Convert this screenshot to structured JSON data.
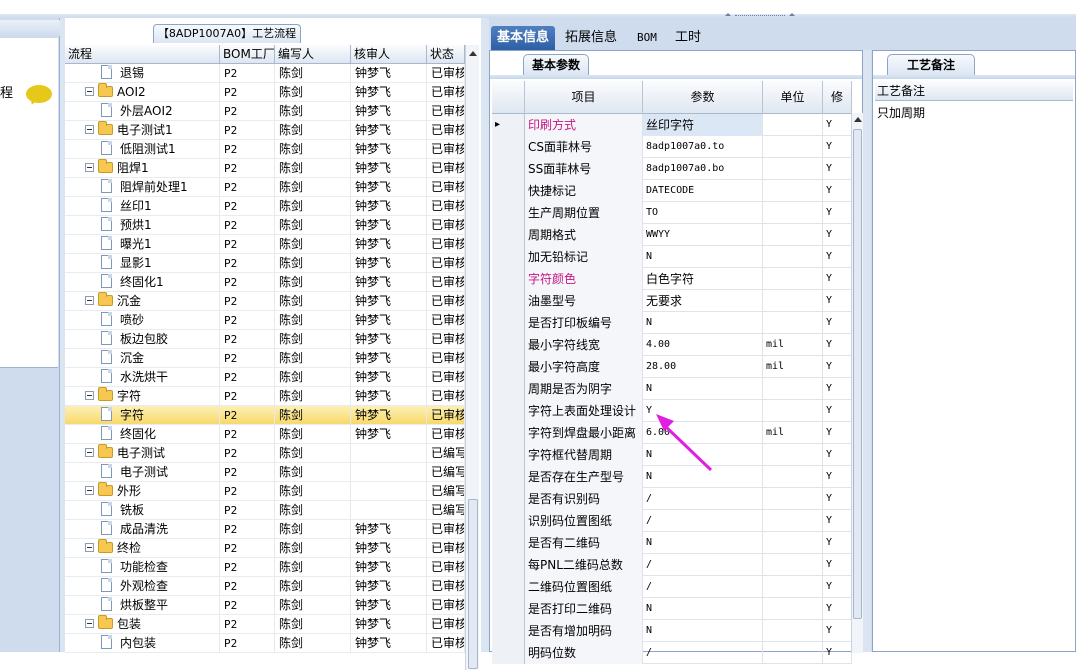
{
  "left_panel": {
    "label": "程"
  },
  "tree": {
    "title": "【8ADP1007A0】工艺流程",
    "columns": [
      "流程",
      "BOM工厂",
      "编写人",
      "核审人",
      "状态"
    ],
    "rows": [
      {
        "type": "doc",
        "indent": 2,
        "name": "退锡",
        "bom": "P2",
        "writer": "陈剑",
        "reviewer": "钟梦飞",
        "status": "已审核"
      },
      {
        "type": "folder",
        "indent": 1,
        "name": "AOI2",
        "bom": "P2",
        "writer": "陈剑",
        "reviewer": "钟梦飞",
        "status": "已审核"
      },
      {
        "type": "doc",
        "indent": 2,
        "name": "外层AOI2",
        "bom": "P2",
        "writer": "陈剑",
        "reviewer": "钟梦飞",
        "status": "已审核"
      },
      {
        "type": "folder",
        "indent": 1,
        "name": "电子测试1",
        "bom": "P2",
        "writer": "陈剑",
        "reviewer": "钟梦飞",
        "status": "已审核"
      },
      {
        "type": "doc",
        "indent": 2,
        "name": "低阻测试1",
        "bom": "P2",
        "writer": "陈剑",
        "reviewer": "钟梦飞",
        "status": "已审核"
      },
      {
        "type": "folder",
        "indent": 1,
        "name": "阻焊1",
        "bom": "P2",
        "writer": "陈剑",
        "reviewer": "钟梦飞",
        "status": "已审核"
      },
      {
        "type": "doc",
        "indent": 2,
        "name": "阻焊前处理1",
        "bom": "P2",
        "writer": "陈剑",
        "reviewer": "钟梦飞",
        "status": "已审核"
      },
      {
        "type": "doc",
        "indent": 2,
        "name": "丝印1",
        "bom": "P2",
        "writer": "陈剑",
        "reviewer": "钟梦飞",
        "status": "已审核"
      },
      {
        "type": "doc",
        "indent": 2,
        "name": "预烘1",
        "bom": "P2",
        "writer": "陈剑",
        "reviewer": "钟梦飞",
        "status": "已审核"
      },
      {
        "type": "doc",
        "indent": 2,
        "name": "曝光1",
        "bom": "P2",
        "writer": "陈剑",
        "reviewer": "钟梦飞",
        "status": "已审核"
      },
      {
        "type": "doc",
        "indent": 2,
        "name": "显影1",
        "bom": "P2",
        "writer": "陈剑",
        "reviewer": "钟梦飞",
        "status": "已审核"
      },
      {
        "type": "doc",
        "indent": 2,
        "name": "终固化1",
        "bom": "P2",
        "writer": "陈剑",
        "reviewer": "钟梦飞",
        "status": "已审核"
      },
      {
        "type": "folder",
        "indent": 1,
        "name": "沉金",
        "bom": "P2",
        "writer": "陈剑",
        "reviewer": "钟梦飞",
        "status": "已审核"
      },
      {
        "type": "doc",
        "indent": 2,
        "name": "喷砂",
        "bom": "P2",
        "writer": "陈剑",
        "reviewer": "钟梦飞",
        "status": "已审核"
      },
      {
        "type": "doc",
        "indent": 2,
        "name": "板边包胶",
        "bom": "P2",
        "writer": "陈剑",
        "reviewer": "钟梦飞",
        "status": "已审核"
      },
      {
        "type": "doc",
        "indent": 2,
        "name": "沉金",
        "bom": "P2",
        "writer": "陈剑",
        "reviewer": "钟梦飞",
        "status": "已审核"
      },
      {
        "type": "doc",
        "indent": 2,
        "name": "水洗烘干",
        "bom": "P2",
        "writer": "陈剑",
        "reviewer": "钟梦飞",
        "status": "已审核"
      },
      {
        "type": "folder",
        "indent": 1,
        "name": "字符",
        "bom": "P2",
        "writer": "陈剑",
        "reviewer": "钟梦飞",
        "status": "已审核"
      },
      {
        "type": "doc",
        "indent": 2,
        "name": "字符",
        "bom": "P2",
        "writer": "陈剑",
        "reviewer": "钟梦飞",
        "status": "已审核",
        "selected": true
      },
      {
        "type": "doc",
        "indent": 2,
        "name": "终固化",
        "bom": "P2",
        "writer": "陈剑",
        "reviewer": "钟梦飞",
        "status": "已审核"
      },
      {
        "type": "folder",
        "indent": 1,
        "name": "电子测试",
        "bom": "P2",
        "writer": "陈剑",
        "reviewer": "",
        "status": "已编写"
      },
      {
        "type": "doc",
        "indent": 2,
        "name": "电子测试",
        "bom": "P2",
        "writer": "陈剑",
        "reviewer": "",
        "status": "已编写"
      },
      {
        "type": "folder",
        "indent": 1,
        "name": "外形",
        "bom": "P2",
        "writer": "陈剑",
        "reviewer": "",
        "status": "已编写"
      },
      {
        "type": "doc",
        "indent": 2,
        "name": "铣板",
        "bom": "P2",
        "writer": "陈剑",
        "reviewer": "",
        "status": "已编写"
      },
      {
        "type": "doc",
        "indent": 2,
        "name": "成品清洗",
        "bom": "P2",
        "writer": "陈剑",
        "reviewer": "钟梦飞",
        "status": "已审核"
      },
      {
        "type": "folder",
        "indent": 1,
        "name": "终检",
        "bom": "P2",
        "writer": "陈剑",
        "reviewer": "钟梦飞",
        "status": "已审核"
      },
      {
        "type": "doc",
        "indent": 2,
        "name": "功能检查",
        "bom": "P2",
        "writer": "陈剑",
        "reviewer": "钟梦飞",
        "status": "已审核"
      },
      {
        "type": "doc",
        "indent": 2,
        "name": "外观检查",
        "bom": "P2",
        "writer": "陈剑",
        "reviewer": "钟梦飞",
        "status": "已审核"
      },
      {
        "type": "doc",
        "indent": 2,
        "name": "烘板整平",
        "bom": "P2",
        "writer": "陈剑",
        "reviewer": "钟梦飞",
        "status": "已审核"
      },
      {
        "type": "folder",
        "indent": 1,
        "name": "包装",
        "bom": "P2",
        "writer": "陈剑",
        "reviewer": "钟梦飞",
        "status": "已审核"
      },
      {
        "type": "doc",
        "indent": 2,
        "name": "内包装",
        "bom": "P2",
        "writer": "陈剑",
        "reviewer": "钟梦飞",
        "status": "已审核"
      }
    ]
  },
  "tabs": {
    "basic": "基本信息",
    "extended": "拓展信息",
    "bom": "BOM",
    "hours": "工时"
  },
  "basic": {
    "subtab": "基本参数",
    "columns": [
      "项目",
      "参数",
      "单位",
      "修"
    ],
    "rows": [
      {
        "name": "印刷方式",
        "value": "丝印字符",
        "unit": "",
        "flag": "Y",
        "hl": true,
        "current": true
      },
      {
        "name": "CS面菲林号",
        "value": "8adp1007a0.to",
        "unit": "",
        "flag": "Y",
        "mono": true
      },
      {
        "name": "SS面菲林号",
        "value": "8adp1007a0.bo",
        "unit": "",
        "flag": "Y",
        "mono": true
      },
      {
        "name": "快捷标记",
        "value": "DATECODE",
        "unit": "",
        "flag": "Y",
        "mono": true
      },
      {
        "name": "生产周期位置",
        "value": "TO",
        "unit": "",
        "flag": "Y",
        "mono": true
      },
      {
        "name": "周期格式",
        "value": "WWYY",
        "unit": "",
        "flag": "Y",
        "mono": true
      },
      {
        "name": "加无铅标记",
        "value": "N",
        "unit": "",
        "flag": "Y",
        "mono": true
      },
      {
        "name": "字符颜色",
        "value": "白色字符",
        "unit": "",
        "flag": "Y",
        "hl": true
      },
      {
        "name": "油墨型号",
        "value": "无要求",
        "unit": "",
        "flag": "Y"
      },
      {
        "name": "是否打印板编号",
        "value": "N",
        "unit": "",
        "flag": "Y",
        "mono": true
      },
      {
        "name": "最小字符线宽",
        "value": "4.00",
        "unit": "mil",
        "flag": "Y",
        "mono": true
      },
      {
        "name": "最小字符高度",
        "value": "28.00",
        "unit": "mil",
        "flag": "Y",
        "mono": true
      },
      {
        "name": "周期是否为阴字",
        "value": "N",
        "unit": "",
        "flag": "Y",
        "mono": true
      },
      {
        "name": "字符上表面处理设计",
        "value": "Y",
        "unit": "",
        "flag": "Y",
        "mono": true
      },
      {
        "name": "字符到焊盘最小距离",
        "value": "6.00",
        "unit": "mil",
        "flag": "Y",
        "mono": true
      },
      {
        "name": "字符框代替周期",
        "value": "N",
        "unit": "",
        "flag": "Y",
        "mono": true
      },
      {
        "name": "是否存在生产型号",
        "value": "N",
        "unit": "",
        "flag": "Y",
        "mono": true
      },
      {
        "name": "是否有识别码",
        "value": "/",
        "unit": "",
        "flag": "Y",
        "mono": true
      },
      {
        "name": "识别码位置图纸",
        "value": "/",
        "unit": "",
        "flag": "Y",
        "mono": true
      },
      {
        "name": "是否有二维码",
        "value": "N",
        "unit": "",
        "flag": "Y",
        "mono": true
      },
      {
        "name": "每PNL二维码总数",
        "value": "/",
        "unit": "",
        "flag": "Y",
        "mono": true
      },
      {
        "name": "二维码位置图纸",
        "value": "/",
        "unit": "",
        "flag": "Y",
        "mono": true
      },
      {
        "name": "是否打印二维码",
        "value": "N",
        "unit": "",
        "flag": "Y",
        "mono": true
      },
      {
        "name": "是否有增加明码",
        "value": "N",
        "unit": "",
        "flag": "Y",
        "mono": true
      },
      {
        "name": "明码位数",
        "value": "/",
        "unit": "",
        "flag": "Y",
        "mono": true
      }
    ]
  },
  "notes": {
    "tab": "工艺备注",
    "header": "工艺备注",
    "value": "只加周期"
  },
  "colors": {
    "accent": "#2e5fa5",
    "highlight_text": "#c71585",
    "arrow": "#e020e0",
    "selection": "#f8d96a"
  }
}
